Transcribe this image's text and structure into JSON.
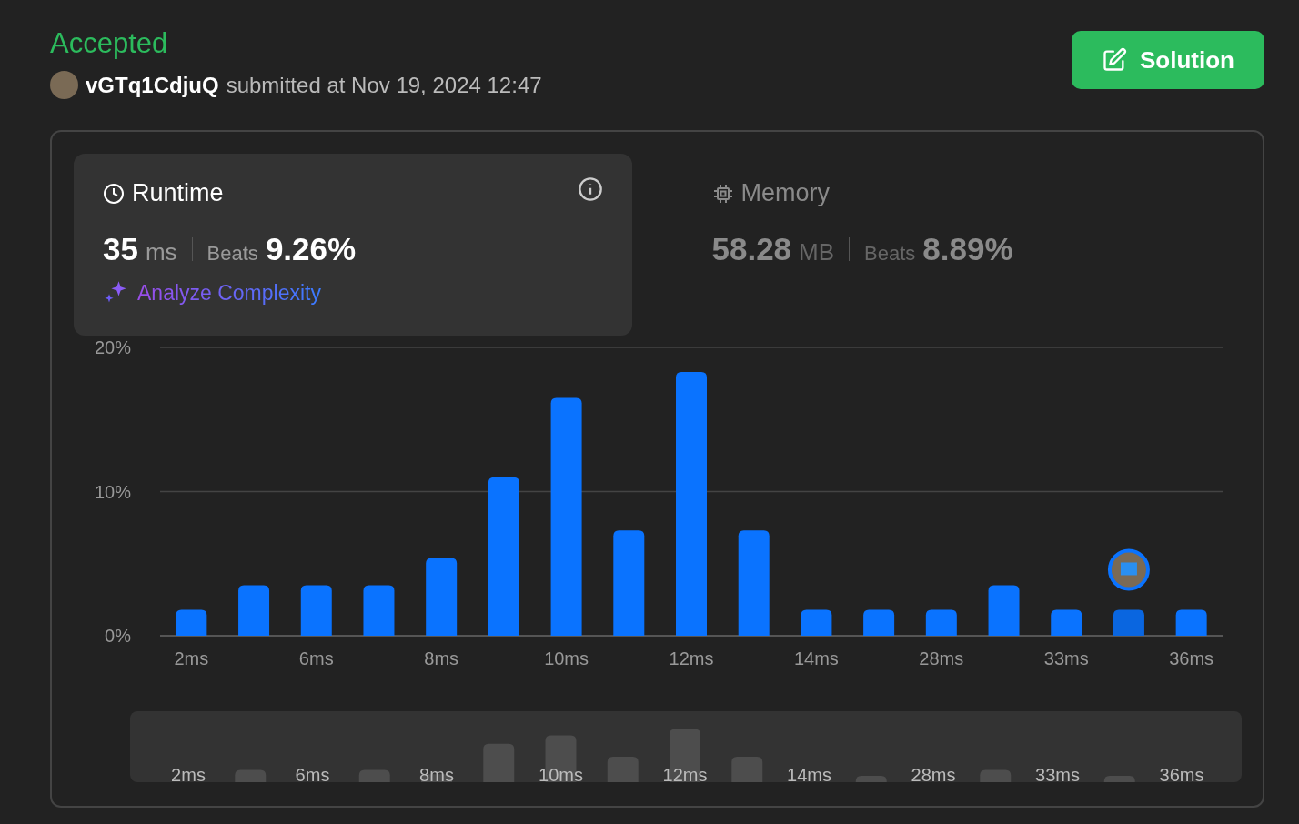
{
  "status": "Accepted",
  "submission": {
    "user": "vGTq1CdjuQ",
    "submitted": "submitted at Nov 19, 2024 12:47"
  },
  "solution_button": "Solution",
  "runtime": {
    "title": "Runtime",
    "selected": true,
    "value": "35",
    "unit": "ms",
    "beats_label": "Beats",
    "beats": "9.26%",
    "analyze_link": "Analyze Complexity"
  },
  "memory": {
    "title": "Memory",
    "selected": false,
    "value": "58.28",
    "unit": "MB",
    "beats_label": "Beats",
    "beats": "8.89%"
  },
  "chart": {
    "chart_data": {
      "type": "bar",
      "categories": [
        "2ms",
        null,
        "6ms",
        null,
        "8ms",
        null,
        "10ms",
        null,
        "12ms",
        null,
        "14ms",
        null,
        "28ms",
        null,
        "33ms",
        null,
        "36ms"
      ],
      "values": [
        1.8,
        3.5,
        3.5,
        3.5,
        5.4,
        11.0,
        16.5,
        7.3,
        18.3,
        7.3,
        1.8,
        1.8,
        1.8,
        3.5,
        1.8,
        1.8,
        1.8
      ],
      "yticks": [
        {
          "value": 0,
          "label": "0%"
        },
        {
          "value": 10,
          "label": "10%"
        },
        {
          "value": 20,
          "label": "20%"
        }
      ],
      "ylim": [
        0,
        20
      ]
    },
    "bars": [
      {
        "selected": false
      },
      {
        "selected": false
      },
      {
        "selected": false
      },
      {
        "selected": false
      },
      {
        "selected": false
      },
      {
        "selected": false
      },
      {
        "selected": false
      },
      {
        "selected": false
      },
      {
        "selected": false
      },
      {
        "selected": false
      },
      {
        "selected": false
      },
      {
        "selected": false
      },
      {
        "selected": false
      },
      {
        "selected": false
      },
      {
        "selected": false
      },
      {
        "selected": true
      },
      {
        "selected": false
      }
    ]
  },
  "overview": {
    "labels": [
      "2ms",
      "6ms",
      "8ms",
      "10ms",
      "12ms",
      "14ms",
      "28ms",
      "33ms",
      "36ms"
    ]
  }
}
